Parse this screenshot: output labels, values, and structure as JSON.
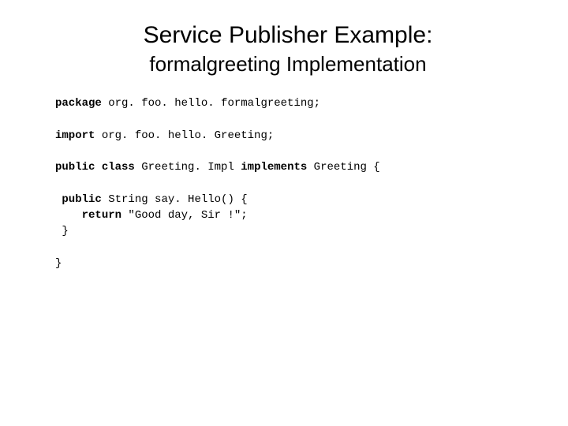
{
  "title": "Service Publisher Example:",
  "subtitle": "formalgreeting Implementation",
  "kw_package": "package",
  "pkg_name": " org. foo. hello. formalgreeting;",
  "kw_import": "import",
  "import_name": " org. foo. hello. Greeting;",
  "kw_public1": "public",
  "kw_class": " class",
  "class_name": " Greeting. Impl ",
  "kw_implements": "implements",
  "iface": " Greeting {",
  "kw_public2": "public",
  "method_sig": " String say. Hello() {",
  "kw_return": "return",
  "return_val": " \"Good day, Sir !\";",
  "brace1": " }",
  "brace2": "}"
}
